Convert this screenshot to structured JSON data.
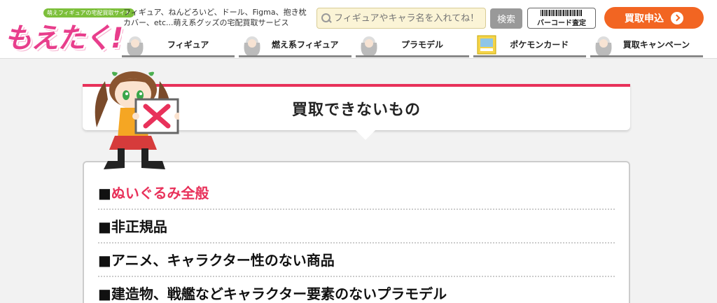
{
  "header": {
    "logo_badge": "萌えフィギュアの宅配買取サイト",
    "logo_text": "もえたく!",
    "tagline": "フィギュア、ねんどろいど、ドール、Figma、抱き枕カバー、etc...萌え系グッズの宅配買取サービス",
    "search_placeholder": "フィギュアやキャラ名を入れてね！",
    "search_button": "検索",
    "barcode_button": "バーコード査定",
    "apply_button": "買取申込"
  },
  "nav": {
    "items": [
      {
        "label": "フィギュア"
      },
      {
        "label": "燃え系フィギュア"
      },
      {
        "label": "プラモデル"
      },
      {
        "label": "ポケモンカード"
      },
      {
        "label": "買取キャンペーン"
      }
    ]
  },
  "main": {
    "title": "買取できないもの",
    "items": [
      {
        "mark": "■",
        "text": "ぬいぐるみ全般"
      },
      {
        "mark": "■",
        "text": "非正規品"
      },
      {
        "mark": "■",
        "text": "アニメ、キャラクター性のない商品"
      },
      {
        "mark": "■",
        "text": "建造物、戦艦などキャラクター要素のないプラモデル"
      }
    ]
  },
  "colors": {
    "accent": "#e8315a",
    "apply": "#f26522",
    "logo": "#e83e8c"
  }
}
